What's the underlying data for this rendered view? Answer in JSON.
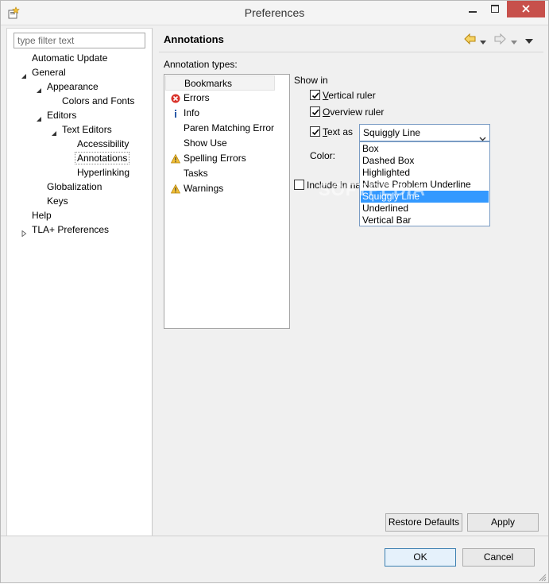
{
  "window": {
    "title": "Preferences",
    "icon": "preferences-icon",
    "controls": [
      "minimize-icon",
      "maximize-icon",
      "close-icon"
    ]
  },
  "sidebar": {
    "filter_placeholder": "type filter text",
    "tree": [
      {
        "label": "Automatic Update",
        "level": 0,
        "expanded": null
      },
      {
        "label": "General",
        "level": 0,
        "expanded": true
      },
      {
        "label": "Appearance",
        "level": 1,
        "expanded": true
      },
      {
        "label": "Colors and Fonts",
        "level": 2,
        "expanded": null
      },
      {
        "label": "Editors",
        "level": 1,
        "expanded": true
      },
      {
        "label": "Text Editors",
        "level": 2,
        "expanded": true
      },
      {
        "label": "Accessibility",
        "level": 3,
        "expanded": null
      },
      {
        "label": "Annotations",
        "level": 3,
        "expanded": null,
        "selected": true
      },
      {
        "label": "Hyperlinking",
        "level": 3,
        "expanded": null
      },
      {
        "label": "Globalization",
        "level": 1,
        "expanded": null
      },
      {
        "label": "Keys",
        "level": 1,
        "expanded": null
      },
      {
        "label": "Help",
        "level": 0,
        "expanded": null
      },
      {
        "label": "TLA+ Preferences",
        "level": 0,
        "expanded": false
      }
    ]
  },
  "page": {
    "title": "Annotations",
    "nav_icons": [
      "back-arrow-icon",
      "back-menu-icon",
      "forward-arrow-icon",
      "forward-menu-icon",
      "view-menu-icon"
    ],
    "annotation_types_label": "Annotation types:",
    "annotation_types": [
      {
        "label": "Bookmarks",
        "icon": null,
        "selected": true
      },
      {
        "label": "Errors",
        "icon": "error-icon"
      },
      {
        "label": "Info",
        "icon": "info-icon"
      },
      {
        "label": "Paren Matching Error",
        "icon": null
      },
      {
        "label": "Show Use",
        "icon": null
      },
      {
        "label": "Spelling Errors",
        "icon": "warning-icon"
      },
      {
        "label": "Tasks",
        "icon": null
      },
      {
        "label": "Warnings",
        "icon": "warning-icon"
      }
    ],
    "show_in_label": "Show in",
    "vertical_ruler": {
      "label": "Vertical ruler",
      "checked": true
    },
    "overview_ruler": {
      "label": "Overview ruler",
      "checked": true
    },
    "text_as": {
      "label": "Text as",
      "checked": true,
      "value": "Squiggly Line"
    },
    "text_as_options": [
      "Box",
      "Dashed Box",
      "Highlighted",
      "Native Problem Underline",
      "Squiggly Line",
      "Underlined",
      "Vertical Bar"
    ],
    "text_as_selected": "Squiggly Line",
    "color_label": "Color:",
    "include_label": "Include in na",
    "include_checked": false,
    "restore_defaults": "Restore Defaults",
    "apply": "Apply"
  },
  "footer": {
    "ok": "OK",
    "cancel": "Cancel"
  },
  "watermark": "SOFTPEDIA",
  "colors": {
    "window_bg": "#f0f0f0",
    "close_button": "#c7504b",
    "selection_blue": "#3399ff",
    "error_red": "#d9322a",
    "warning_yellow": "#f2c037",
    "info_blue": "#2a5ba8"
  }
}
